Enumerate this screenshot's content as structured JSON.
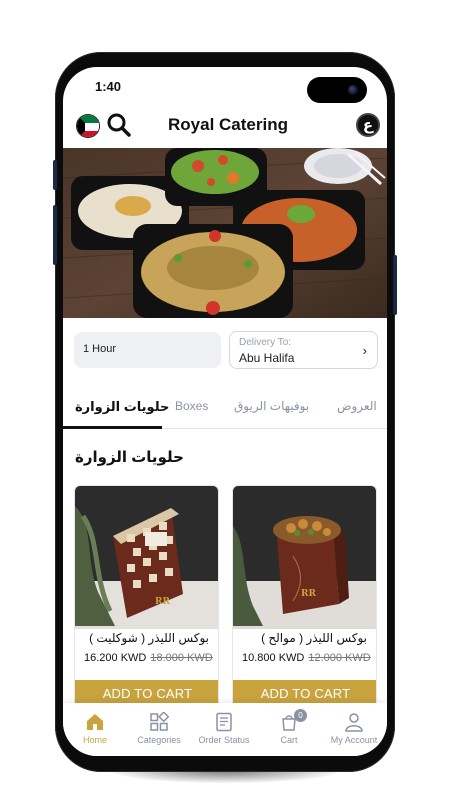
{
  "status_bar": {
    "time": "1:40"
  },
  "header": {
    "title": "Royal Catering",
    "language_toggle": "ع"
  },
  "info": {
    "delivery_time": "1 Hour",
    "delivery_label": "Delivery To:",
    "delivery_area": "Abu Halifa",
    "chevron": "›"
  },
  "tabs": [
    {
      "label": "حلويات الزوارة",
      "active": true
    },
    {
      "label": "Boxes",
      "active": false
    },
    {
      "label": "بوفيهات الريوق",
      "active": false
    },
    {
      "label": "العروض",
      "active": false
    }
  ],
  "section": {
    "title": "حلويات الزوارة"
  },
  "products": [
    {
      "name": "بوكس الليذر ( شوكليت )",
      "price": "16.200 KWD",
      "old_price": "18.000 KWD",
      "button": "ADD TO CART"
    },
    {
      "name": "بوكس الليذر ( موالح )",
      "price": "10.800 KWD",
      "old_price": "12.000 KWD",
      "button": "ADD TO CART"
    }
  ],
  "bottom_nav": [
    {
      "label": "Home",
      "icon": "home-icon",
      "active": true
    },
    {
      "label": "Categories",
      "icon": "categories-icon",
      "active": false
    },
    {
      "label": "Order Status",
      "icon": "order-status-icon",
      "active": false
    },
    {
      "label": "Cart",
      "icon": "cart-icon",
      "active": false,
      "badge": "0"
    },
    {
      "label": "My Account",
      "icon": "account-icon",
      "active": false
    }
  ],
  "colors": {
    "accent": "#c9a33e",
    "muted": "#8a93a3",
    "text": "#111111"
  }
}
